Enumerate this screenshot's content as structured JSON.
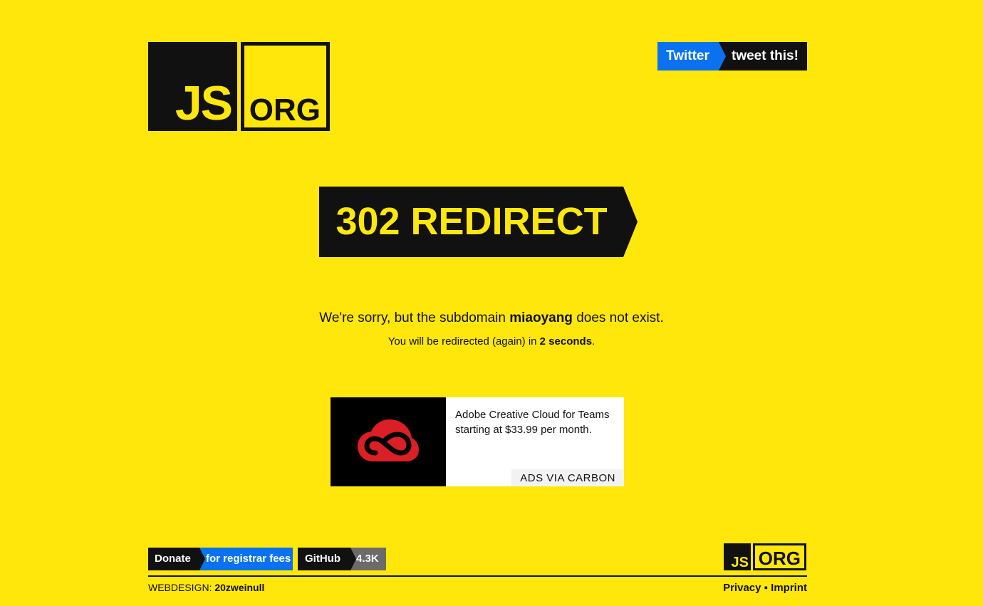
{
  "header": {
    "logo": {
      "js": "JS",
      "org": "ORG"
    },
    "tweet": {
      "service": "Twitter",
      "action": "tweet this!"
    }
  },
  "headline": {
    "text": "302 REDIRECT"
  },
  "message": {
    "prefix": "We're sorry, but the subdomain ",
    "subdomain": "miaoyang",
    "suffix": " does not exist.",
    "redirect_prefix": "You will be redirected (again) in ",
    "redirect_time": "2 seconds",
    "redirect_suffix": "."
  },
  "ad": {
    "text": "Adobe Creative Cloud for Teams starting at $33.99 per month.",
    "via": "ADS VIA CARBON"
  },
  "footer": {
    "donate": {
      "label": "Donate",
      "detail": "for registrar fees"
    },
    "github": {
      "label": "GitHub",
      "count": "4.3K"
    },
    "logo": {
      "js": "JS",
      "org": "ORG"
    },
    "webdesign_label": "WEBDESIGN:",
    "webdesign_name": "20zweinull",
    "privacy": "Privacy",
    "separator": "▪",
    "imprint": "Imprint"
  },
  "colors": {
    "background": "#ffe70b",
    "dark": "#111111",
    "twitter_blue": "#0a72f0",
    "github_gray": "#6b6b6b",
    "adobe_red": "#da1f26"
  }
}
